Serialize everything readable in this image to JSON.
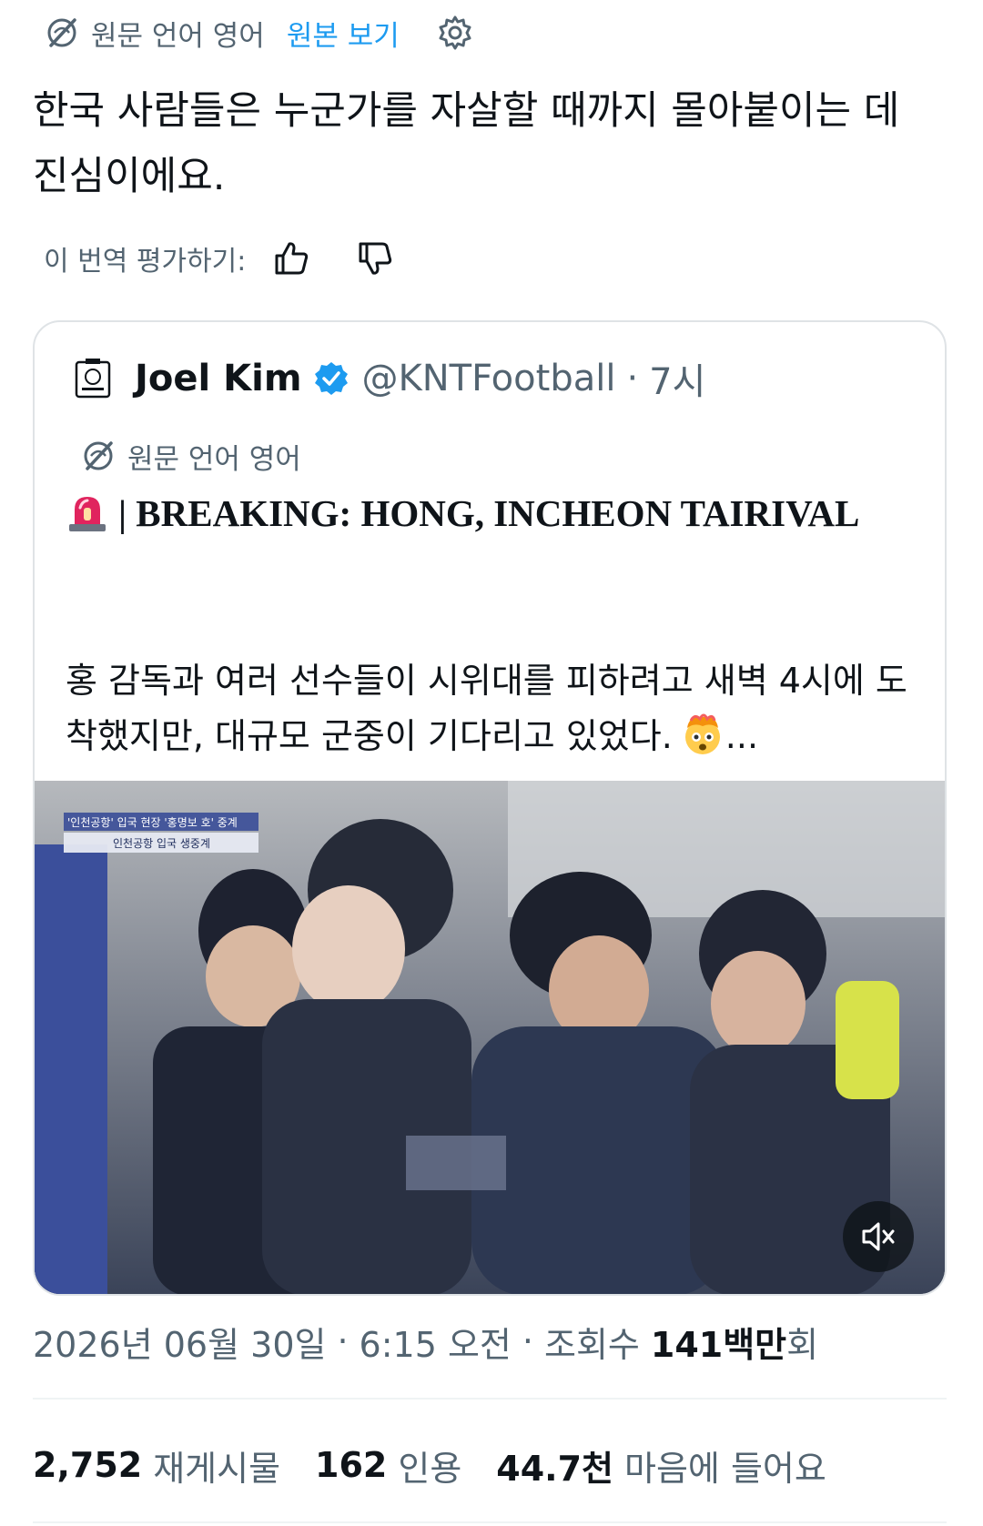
{
  "translation": {
    "source_language_label": "원문 언어 영어",
    "show_original_label": "원본 보기"
  },
  "tweet": {
    "text": "한국 사람들은 누군가를 자살할 때까지 몰아붙이는 데 진심이에요."
  },
  "rate_translation": {
    "label": "이 번역 평가하기:"
  },
  "quoted_tweet": {
    "author_name": "Joel Kim",
    "handle": "@KNTFootball",
    "dot": "·",
    "time": "7시",
    "source_language_label": "원문 언어 영어",
    "headline": "| BREAKING: HONG, INCHEON TAIRIVAL",
    "body": "홍 감독과 여러 선수들이 시위대를 피하려고 새벽 4시에 도착했지만, 대규모 군중이 기다리고 있었다.",
    "ellipsis": "...",
    "video_overlay_line1": "'인천공항' 입국 현장 '홍명보 호' 중계",
    "video_overlay_line2": "인천공항 입국 생중계"
  },
  "meta": {
    "date": "2026년 06월 30일",
    "time": "6:15 오전",
    "dot": "·",
    "views_label": "조회수",
    "views_count": "141백만",
    "views_suffix": "회"
  },
  "stats": {
    "retweets_count": "2,752",
    "retweets_label": "재게시물",
    "quotes_count": "162",
    "quotes_label": "인용",
    "likes_count": "44.7천",
    "likes_label": "마음에 들어요"
  },
  "icons": {
    "translate": "globe-slash-icon",
    "settings": "gear-icon",
    "thumbs_up": "thumbs-up-icon",
    "thumbs_down": "thumbs-down-icon",
    "verified": "verified-badge-icon",
    "siren": "siren-emoji-icon",
    "shocked": "exploding-head-emoji-icon",
    "mute": "speaker-muted-icon"
  },
  "colors": {
    "link": "#1d9bf0",
    "secondary_text": "#536471",
    "primary_text": "#0f1419",
    "verified": "#1d9bf0"
  }
}
